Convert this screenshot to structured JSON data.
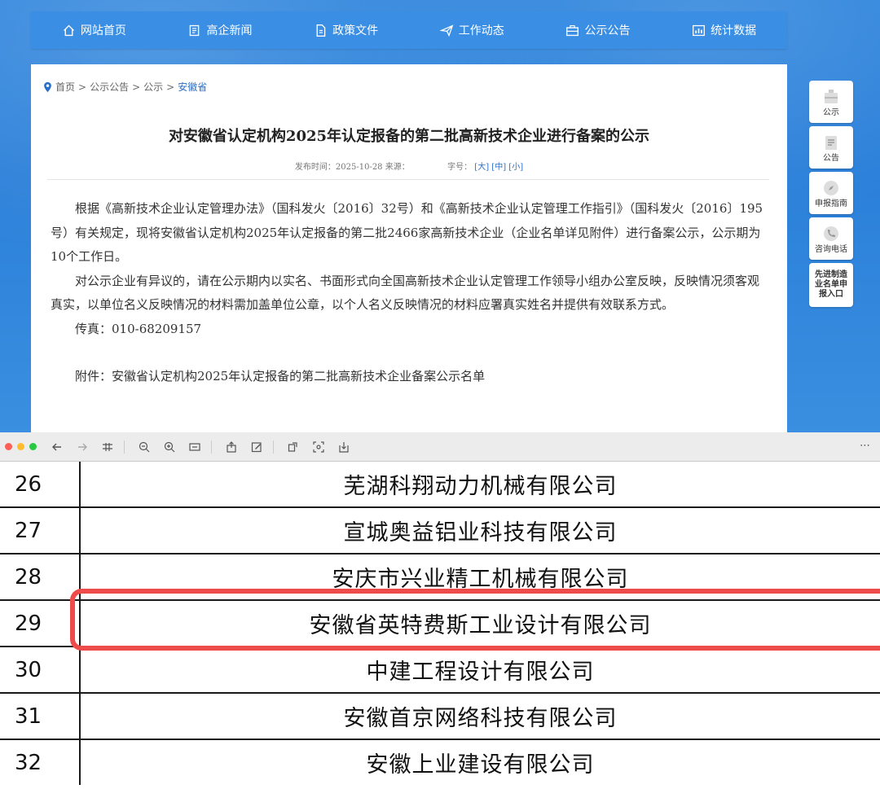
{
  "nav": {
    "items": [
      {
        "label": "网站首页",
        "icon": "home-icon"
      },
      {
        "label": "高企新闻",
        "icon": "news-icon"
      },
      {
        "label": "政策文件",
        "icon": "document-icon"
      },
      {
        "label": "工作动态",
        "icon": "paper-plane-icon"
      },
      {
        "label": "公示公告",
        "icon": "briefcase-icon"
      },
      {
        "label": "统计数据",
        "icon": "bar-chart-icon"
      }
    ]
  },
  "breadcrumb": {
    "home": "首页",
    "sep": ">",
    "level1": "公示公告",
    "level2": "公示",
    "current": "安徽省"
  },
  "article": {
    "title": "对安徽省认定机构2025年认定报备的第二批高新技术企业进行备案的公示",
    "meta_date": "发布时间：2025-10-28 来源：",
    "meta_size_label": "字号：",
    "size_large": "[大]",
    "size_medium": "[中]",
    "size_small": "[小]",
    "p1": "根据《高新技术企业认定管理办法》（国科发火〔2016〕32号）和《高新技术企业认定管理工作指引》（国科发火〔2016〕195号）有关规定，现将安徽省认定机构2025年认定报备的第二批2466家高新技术企业（企业名单详见附件）进行备案公示，公示期为10个工作日。",
    "p2": "对公示企业有异议的，请在公示期内以实名、书面形式向全国高新技术企业认定管理工作领导小组办公室反映，反映情况须客观真实，以单位名义反映情况的材料需加盖单位公章，以个人名义反映情况的材料应署真实姓名并提供有效联系方式。",
    "fax": "传真：010-68209157",
    "attachment": "附件：安徽省认定机构2025年认定报备的第二批高新技术企业备案公示名单"
  },
  "sidebar": {
    "items": [
      {
        "label": "公示",
        "icon": "briefcase-icon"
      },
      {
        "label": "公告",
        "icon": "notice-icon"
      },
      {
        "label": "申报指南",
        "icon": "compass-icon"
      },
      {
        "label": "咨询电话",
        "icon": "phone-icon"
      },
      {
        "label": "先进制造业名单申报入口",
        "icon": ""
      }
    ]
  },
  "viewer_toolbar": {
    "dots": [
      "#ff5f57",
      "#febc2e",
      "#28c840"
    ]
  },
  "table": {
    "rows": [
      {
        "no": "26",
        "name": "芜湖科翔动力机械有限公司"
      },
      {
        "no": "27",
        "name": "宣城奥益铝业科技有限公司"
      },
      {
        "no": "28",
        "name": "安庆市兴业精工机械有限公司"
      },
      {
        "no": "29",
        "name": "安徽省英特费斯工业设计有限公司"
      },
      {
        "no": "30",
        "name": "中建工程设计有限公司"
      },
      {
        "no": "31",
        "name": "安徽首京网络科技有限公司"
      },
      {
        "no": "32",
        "name": "安徽上业建设有限公司"
      }
    ],
    "highlight_color": "#ee4b4b"
  }
}
